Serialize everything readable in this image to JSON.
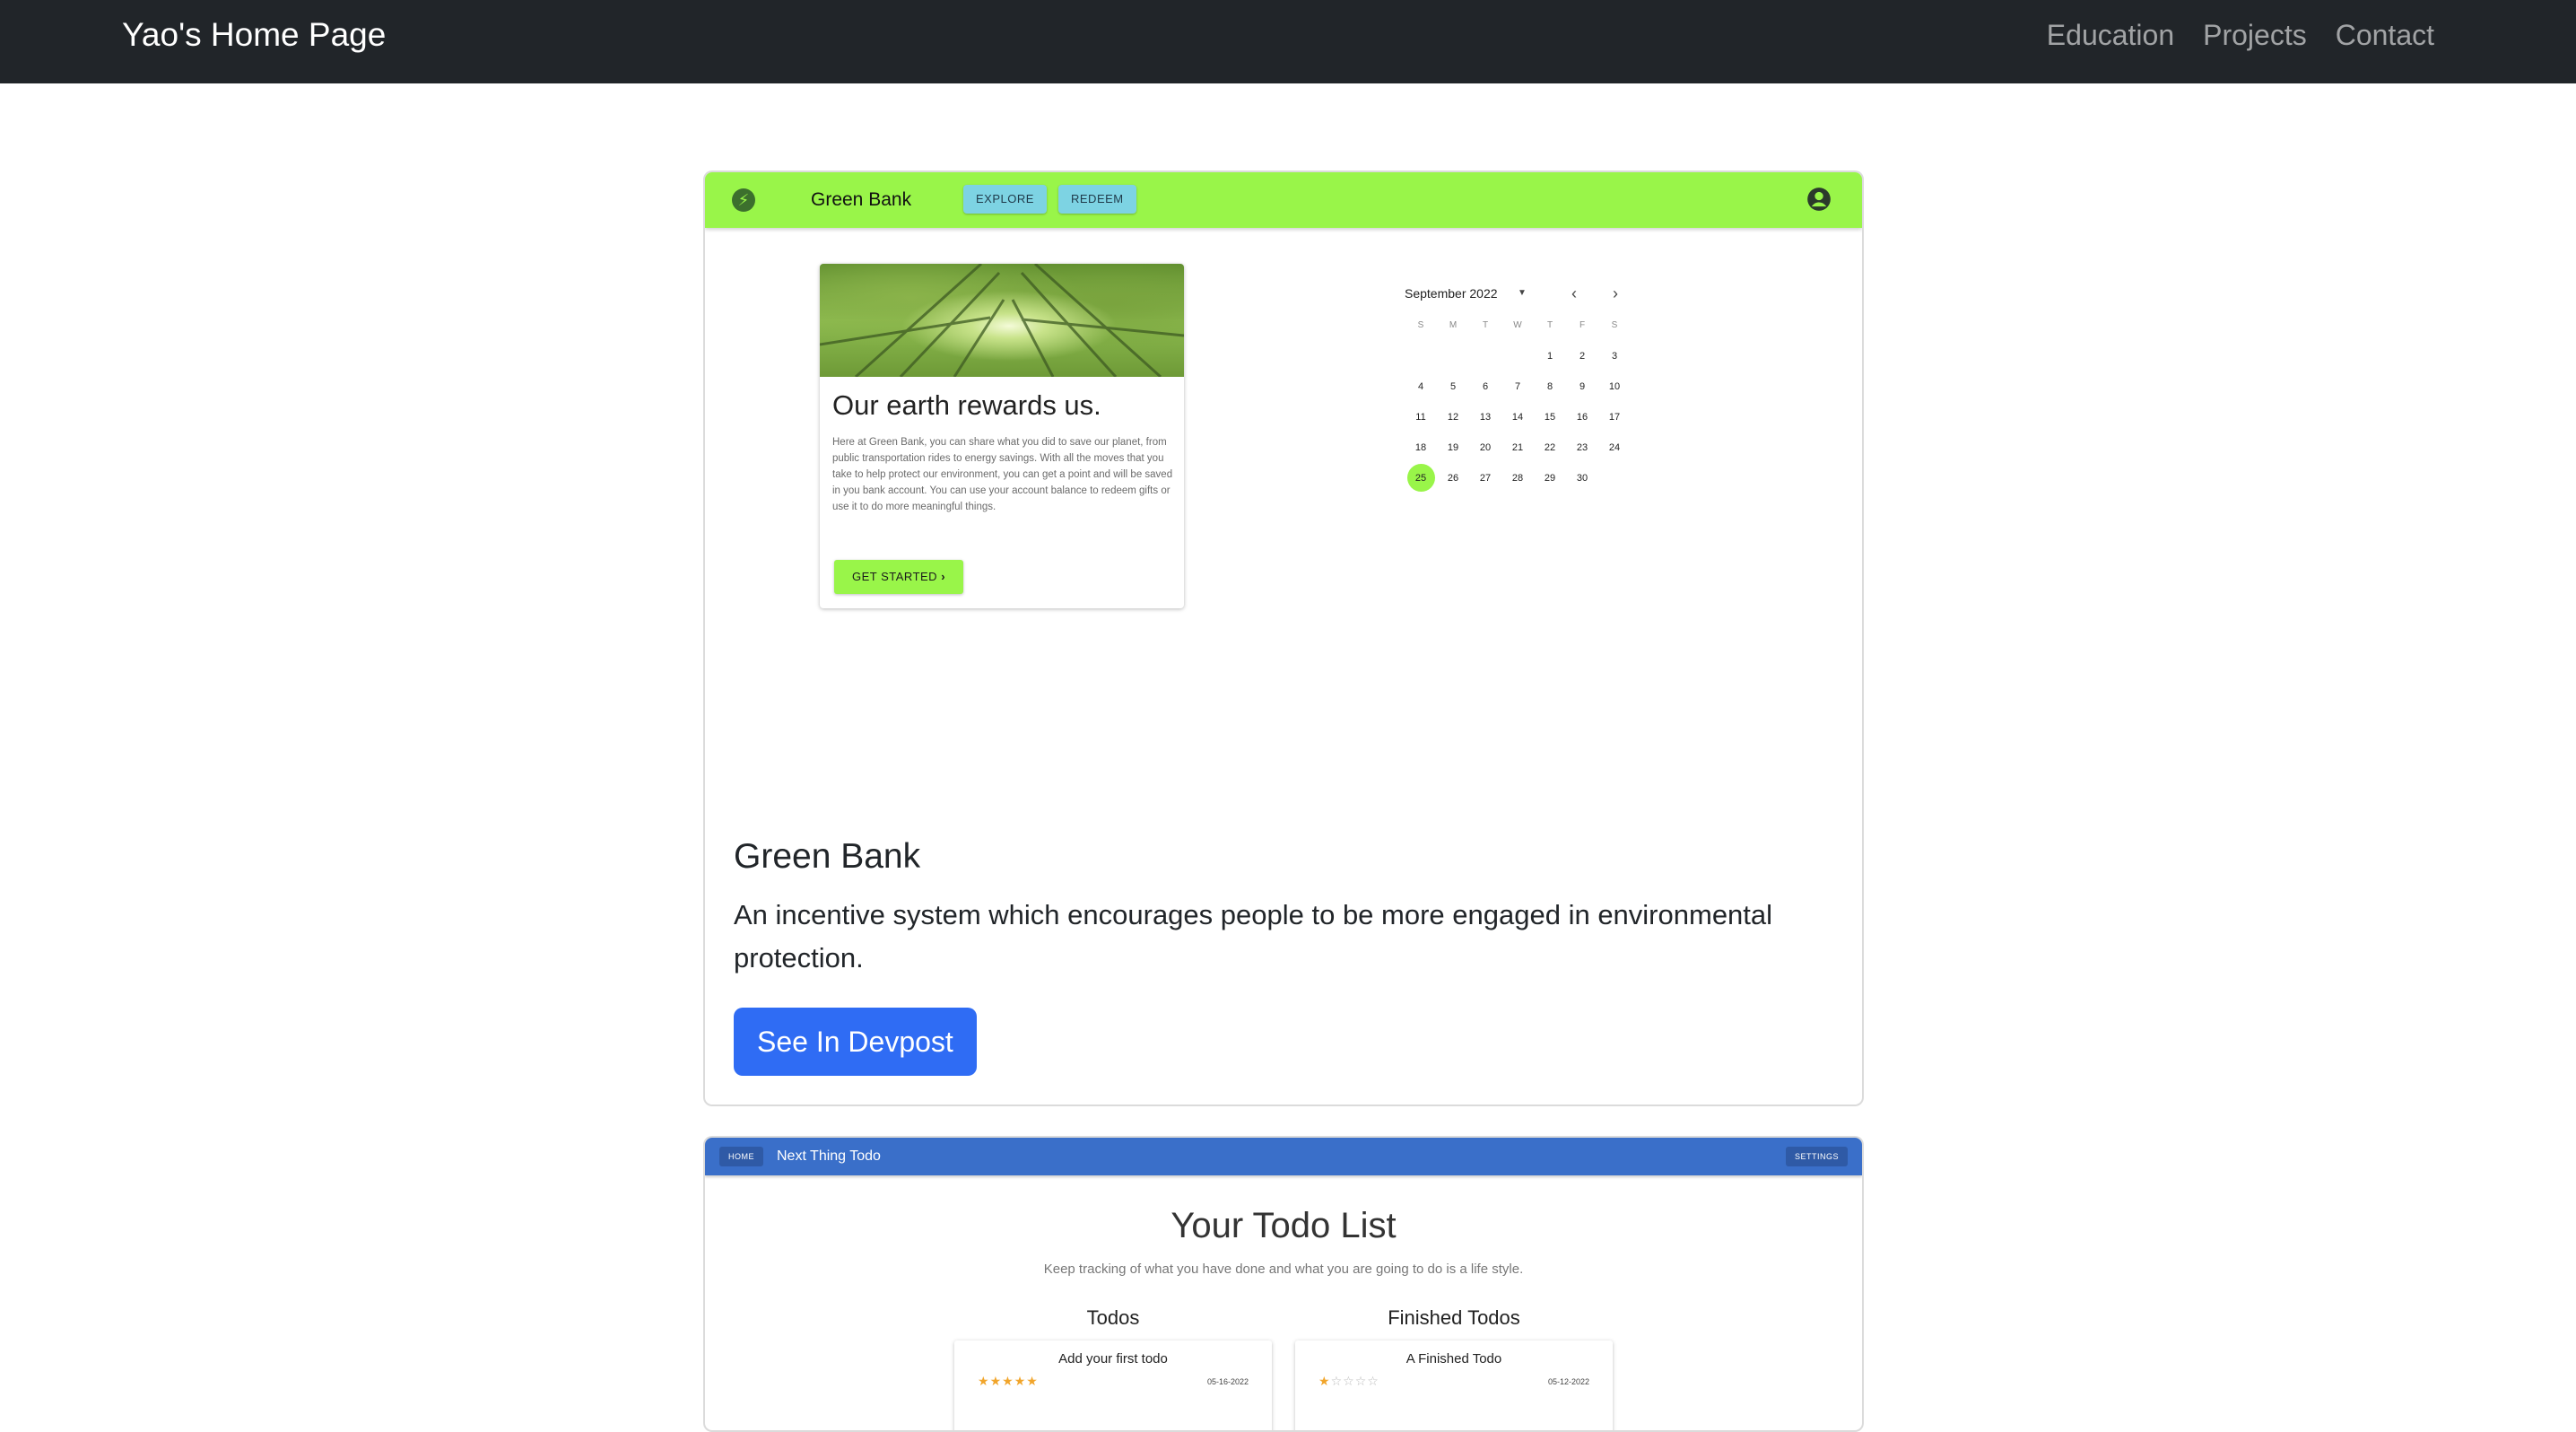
{
  "navbar": {
    "brand": "Yao's Home Page",
    "links": [
      "Education",
      "Projects",
      "Contact"
    ]
  },
  "projects": [
    {
      "screenshot": {
        "appbar": {
          "title": "Green Bank",
          "explore": "EXPLORE",
          "redeem": "REDEEM",
          "logo_icon": "lightning-icon",
          "account_icon": "account-circle-icon",
          "color": "#99f549"
        },
        "hero": {
          "heading": "Our earth rewards us.",
          "body": "Here at Green Bank, you can share what you did to save our planet, from public transportation rides to energy savings. With all the moves that you take to help protect our environment, you can get a point and will be saved in you bank account. You can use your account balance to redeem gifts or use it to do more meaningful things.",
          "button": "GET STARTED"
        },
        "calendar": {
          "month": "September 2022",
          "weekdays": [
            "S",
            "M",
            "T",
            "W",
            "T",
            "F",
            "S"
          ],
          "leading_blanks": 4,
          "days": 30,
          "selected": 25
        }
      },
      "title": "Green Bank",
      "description": "An incentive system which encourages people to be more engaged in environmental protection.",
      "button": "See In Devpost",
      "button_color": "#2f6cf4"
    },
    {
      "screenshot": {
        "appbar": {
          "home": "HOME",
          "title": "Next Thing Todo",
          "settings": "SETTINGS",
          "color": "#3a6fc9"
        },
        "heading": "Your Todo List",
        "subtitle": "Keep tracking of what you have done and what you are going to do is a life style.",
        "columns": [
          {
            "title": "Todos",
            "item": {
              "title": "Add your first todo",
              "stars": 5,
              "date": "05-16-2022"
            }
          },
          {
            "title": "Finished Todos",
            "item": {
              "title": "A Finished Todo",
              "stars": 1,
              "date": "05-12-2022"
            }
          }
        ]
      }
    }
  ]
}
